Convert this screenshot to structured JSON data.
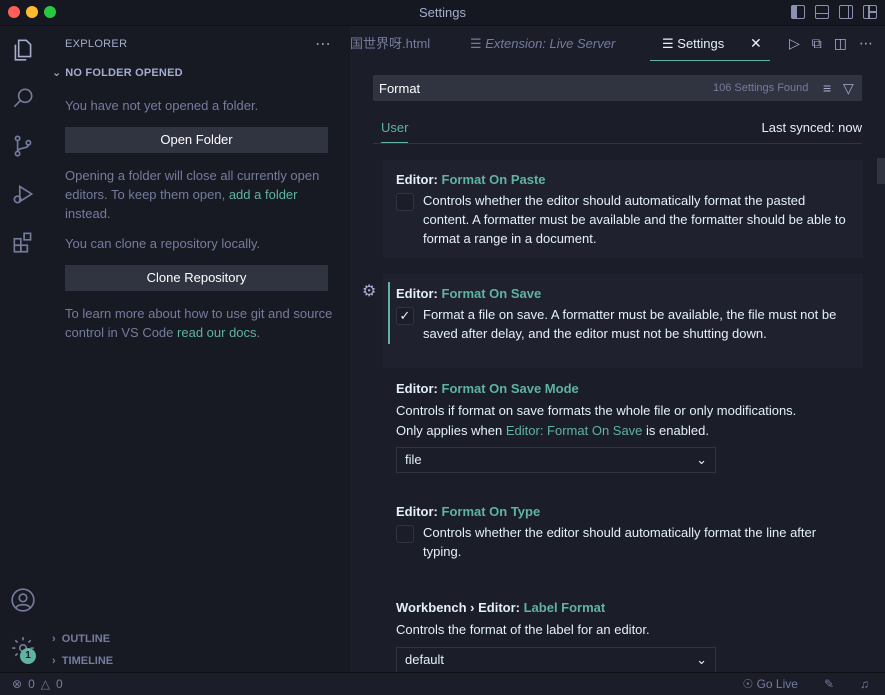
{
  "window": {
    "title": "Settings"
  },
  "sidebar": {
    "header": "EXPLORER",
    "section": "NO FOLDER OPENED",
    "msg_not_opened": "You have not yet opened a folder.",
    "open_folder_button": "Open Folder",
    "msg_close_editors": "Opening a folder will close all currently open editors. To keep them open,",
    "add_folder_link": "add a folder",
    "msg_instead": "instead.",
    "msg_clone": "You can clone a repository locally.",
    "clone_button": "Clone Repository",
    "msg_learn": "To learn more about how to use git and source control in VS Code",
    "docs_link": "read our docs",
    "msg_period": ".",
    "outline": "OUTLINE",
    "timeline": "TIMELINE"
  },
  "activity": {
    "badge": "1"
  },
  "tabs": [
    {
      "label": "国世界呀.html"
    },
    {
      "label": "Extension: Live Server"
    },
    {
      "label": "Settings"
    }
  ],
  "search": {
    "value": "Format",
    "found": "106 Settings Found"
  },
  "scope": {
    "user": "User",
    "synced": "Last synced: now"
  },
  "settings": [
    {
      "prefix": "Editor: ",
      "key": "Format On Paste",
      "desc": "Controls whether the editor should automatically format the pasted content. A formatter must be available and the formatter should be able to format a range in a document.",
      "checked": false
    },
    {
      "prefix": "Editor: ",
      "key": "Format On Save",
      "desc": "Format a file on save. A formatter must be available, the file must not be saved after delay, and the editor must not be shutting down.",
      "checked": true
    },
    {
      "prefix": "Editor: ",
      "key": "Format On Save Mode",
      "desc_a": "Controls if format on save formats the whole file or only modifications.",
      "desc_b": "Only applies when",
      "ref": "Editor: Format On Save",
      "desc_c": "is enabled.",
      "value": "file"
    },
    {
      "prefix": "Editor: ",
      "key": "Format On Type",
      "desc": "Controls whether the editor should automatically format the line after typing.",
      "checked": false
    },
    {
      "prefix": "Workbench › Editor: ",
      "key": "Label Format",
      "desc": "Controls the format of the label for an editor.",
      "value": "default"
    }
  ],
  "status": {
    "errors": "0",
    "warnings": "0",
    "go_live": "Go Live"
  },
  "colors": {
    "accent": "#5fb3a1",
    "background": "#1b1d28",
    "sidebar": "#171923"
  }
}
